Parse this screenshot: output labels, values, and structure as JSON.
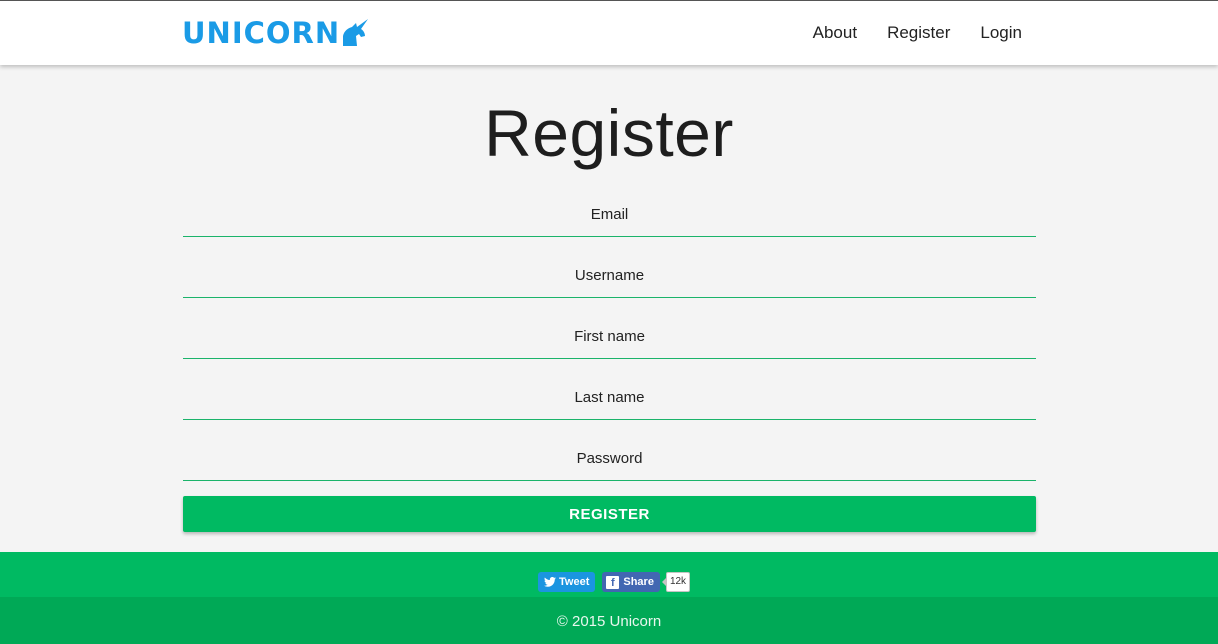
{
  "brand": {
    "name": "UNICORN",
    "color": "#1a9be6",
    "icon": "unicorn-icon"
  },
  "nav": {
    "items": [
      "About",
      "Register",
      "Login"
    ]
  },
  "page": {
    "title": "Register"
  },
  "form": {
    "fields": [
      {
        "placeholder": "Email",
        "value": ""
      },
      {
        "placeholder": "Username",
        "value": ""
      },
      {
        "placeholder": "First name",
        "value": ""
      },
      {
        "placeholder": "Last name",
        "value": ""
      },
      {
        "placeholder": "Password",
        "value": ""
      }
    ],
    "submit_label": "REGISTER",
    "accent_color": "#00ba62"
  },
  "social": {
    "tweet_label": "Tweet",
    "share_label": "Share",
    "share_count": "12k",
    "tweet_icon": "twitter-bird-icon",
    "share_icon": "facebook-icon"
  },
  "footer": {
    "copyright": "© 2015 Unicorn"
  }
}
